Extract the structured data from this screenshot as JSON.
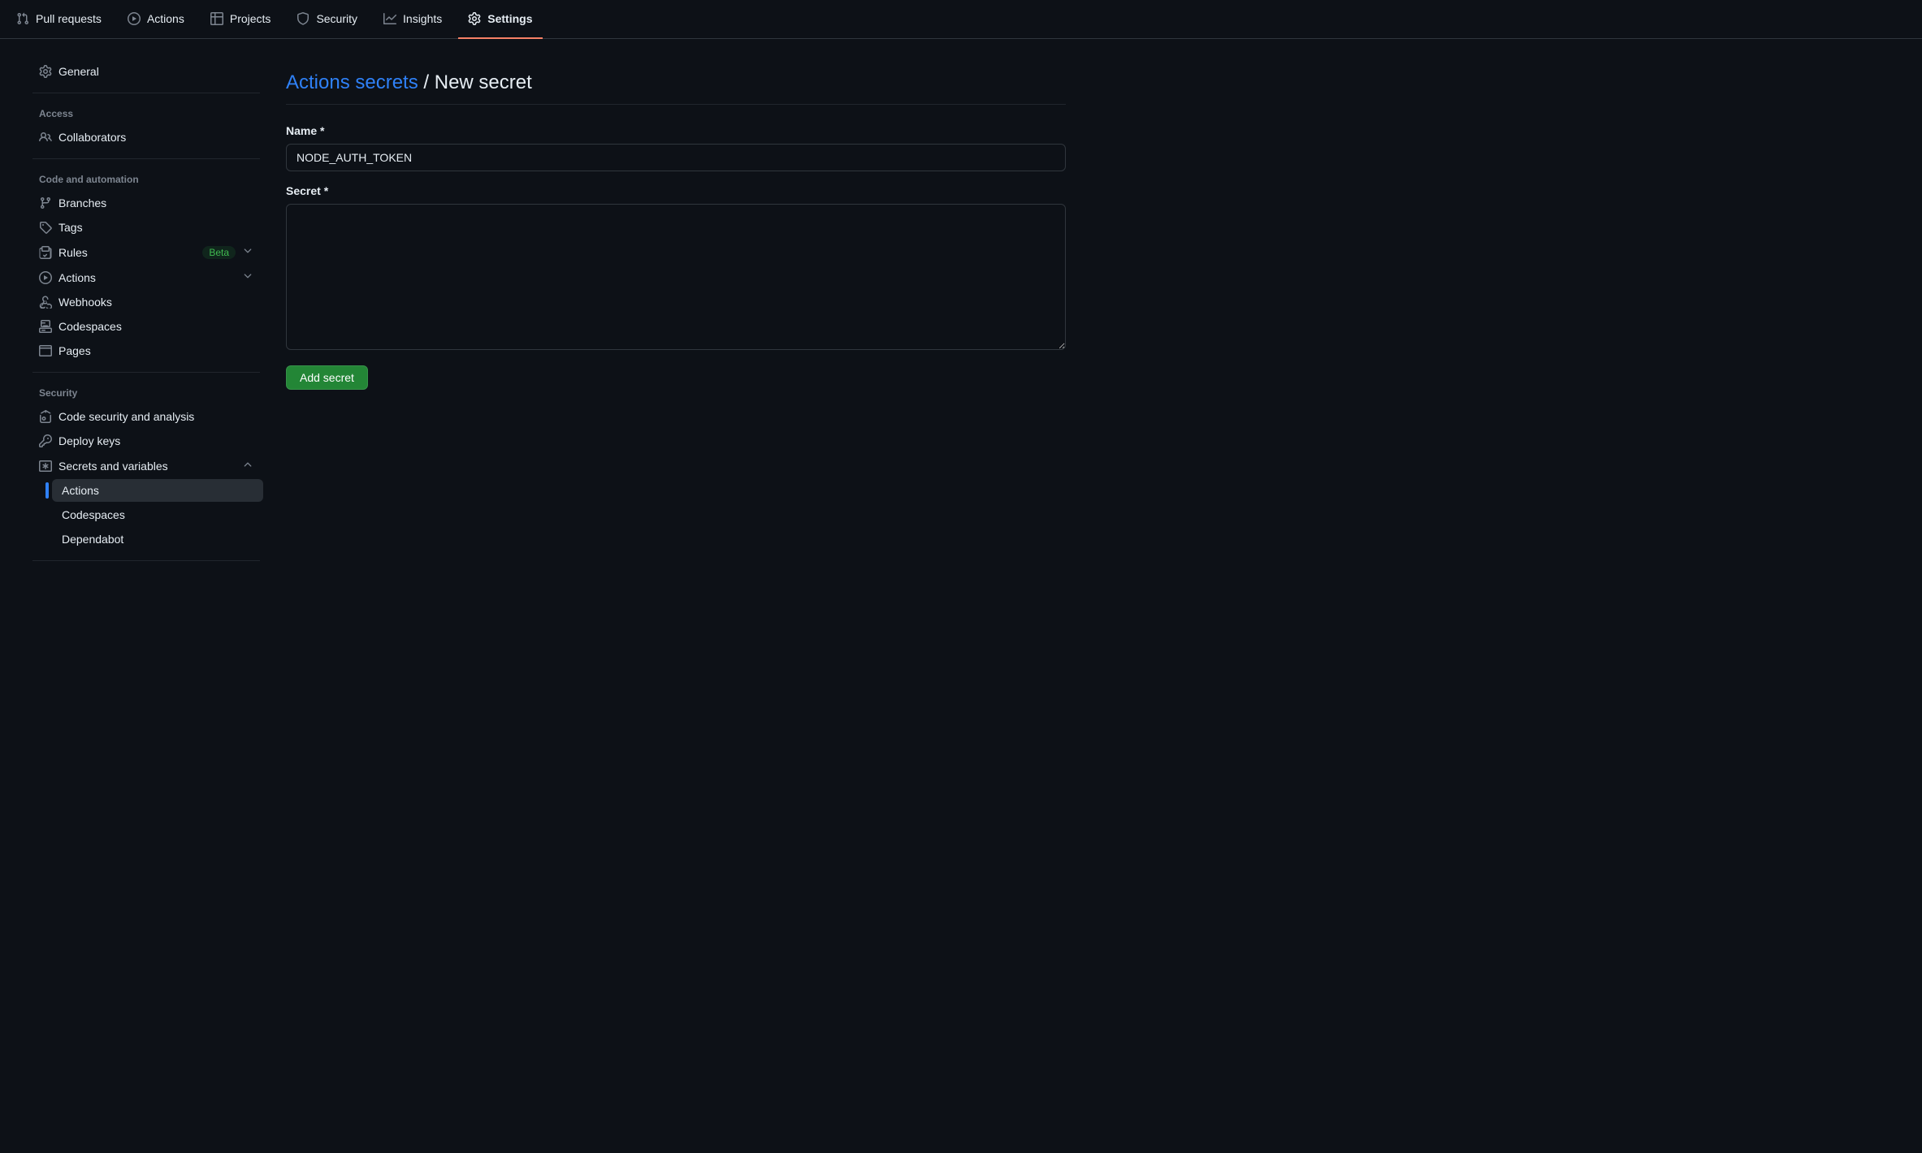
{
  "repo_nav": [
    {
      "icon": "git-pull",
      "label": "Pull requests"
    },
    {
      "icon": "play",
      "label": "Actions"
    },
    {
      "icon": "table",
      "label": "Projects"
    },
    {
      "icon": "shield",
      "label": "Security"
    },
    {
      "icon": "graph",
      "label": "Insights"
    },
    {
      "icon": "gear",
      "label": "Settings",
      "selected": true
    }
  ],
  "sidebar": {
    "general": "General",
    "headings": {
      "access": "Access",
      "code_auto": "Code and automation",
      "security": "Security"
    },
    "access": {
      "collaborators": "Collaborators"
    },
    "code_auto": {
      "branches": "Branches",
      "tags": "Tags",
      "rules": "Rules",
      "rules_badge": "Beta",
      "actions": "Actions",
      "webhooks": "Webhooks",
      "codespaces": "Codespaces",
      "pages": "Pages"
    },
    "security": {
      "code_sec": "Code security and analysis",
      "deploy_keys": "Deploy keys",
      "secrets_vars": "Secrets and variables",
      "sub": {
        "actions": "Actions",
        "codespaces": "Codespaces",
        "dependabot": "Dependabot"
      }
    }
  },
  "main": {
    "breadcrumb_link": "Actions secrets",
    "breadcrumb_sep": "/",
    "breadcrumb_current": "New secret",
    "name_label": "Name *",
    "name_value": "NODE_AUTH_TOKEN",
    "secret_label": "Secret *",
    "secret_value": "",
    "submit_label": "Add secret"
  }
}
